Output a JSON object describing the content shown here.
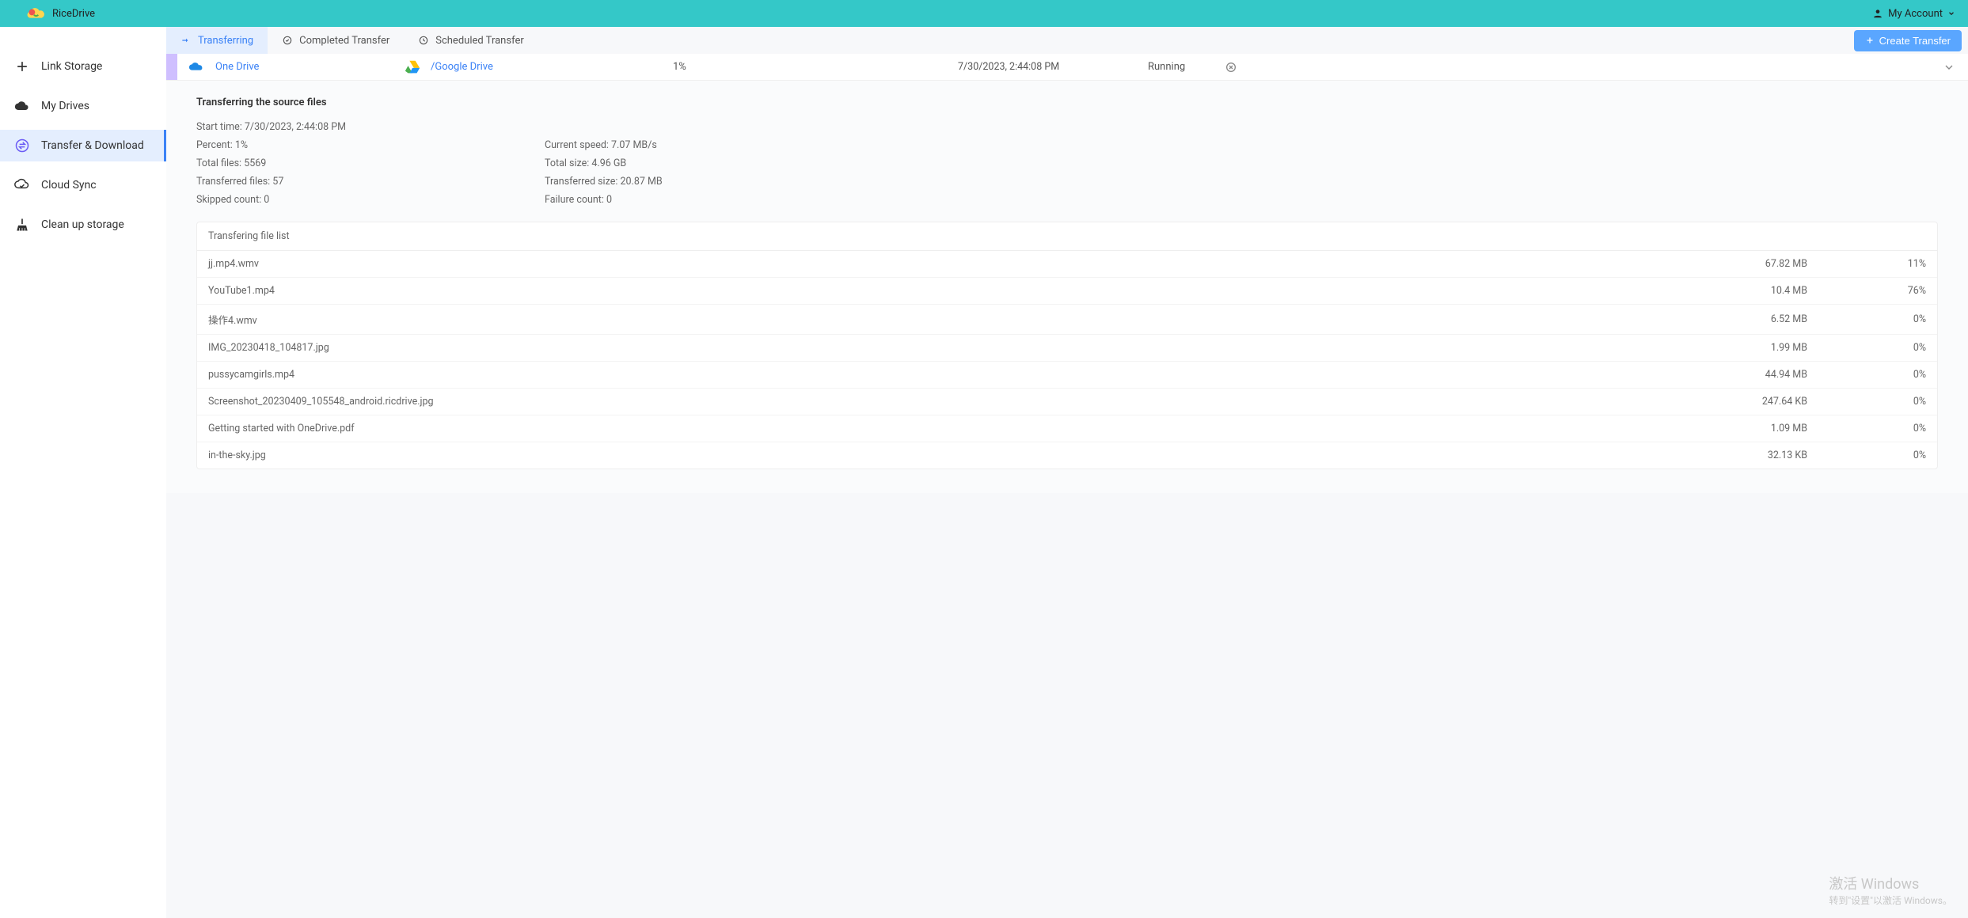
{
  "brand": {
    "name": "RiceDrive"
  },
  "account": {
    "label": "My Account"
  },
  "sidebar": {
    "items": [
      {
        "label": "Link Storage"
      },
      {
        "label": "My Drives"
      },
      {
        "label": "Transfer & Download"
      },
      {
        "label": "Cloud Sync"
      },
      {
        "label": "Clean up storage"
      }
    ]
  },
  "tabs": {
    "transferring": "Transferring",
    "completed": "Completed Transfer",
    "scheduled": "Scheduled Transfer"
  },
  "create_button": "Create Transfer",
  "task": {
    "source": "One Drive",
    "destination": "/Google Drive",
    "percent": "1%",
    "time": "7/30/2023, 2:44:08 PM",
    "status": "Running"
  },
  "details": {
    "title": "Transferring the source files",
    "start_time_label": "Start time: ",
    "start_time": "7/30/2023, 2:44:08 PM",
    "percent_label": "Percent: ",
    "percent": "1%",
    "speed_label": "Current speed: ",
    "speed": "7.07 MB/s",
    "total_files_label": "Total files: ",
    "total_files": "5569",
    "total_size_label": "Total size: ",
    "total_size": "4.96 GB",
    "transferred_files_label": "Transferred files: ",
    "transferred_files": "57",
    "transferred_size_label": "Transferred size: ",
    "transferred_size": "20.87 MB",
    "skipped_label": "Skipped count: ",
    "skipped": "0",
    "failure_label": "Failure count: ",
    "failure": "0"
  },
  "file_list": {
    "header": "Transfering file list",
    "rows": [
      {
        "name": "jj.mp4.wmv",
        "size": "67.82 MB",
        "pct": "11%"
      },
      {
        "name": "YouTube1.mp4",
        "size": "10.4 MB",
        "pct": "76%"
      },
      {
        "name": "操作4.wmv",
        "size": "6.52 MB",
        "pct": "0%"
      },
      {
        "name": "IMG_20230418_104817.jpg",
        "size": "1.99 MB",
        "pct": "0%"
      },
      {
        "name": "pussycamgirls.mp4",
        "size": "44.94 MB",
        "pct": "0%"
      },
      {
        "name": "Screenshot_20230409_105548_android.ricdrive.jpg",
        "size": "247.64 KB",
        "pct": "0%"
      },
      {
        "name": "Getting started with OneDrive.pdf",
        "size": "1.09 MB",
        "pct": "0%"
      },
      {
        "name": "in-the-sky.jpg",
        "size": "32.13 KB",
        "pct": "0%"
      }
    ]
  },
  "watermark": {
    "line1": "激活 Windows",
    "line2": "转到\"设置\"以激活 Windows。"
  }
}
